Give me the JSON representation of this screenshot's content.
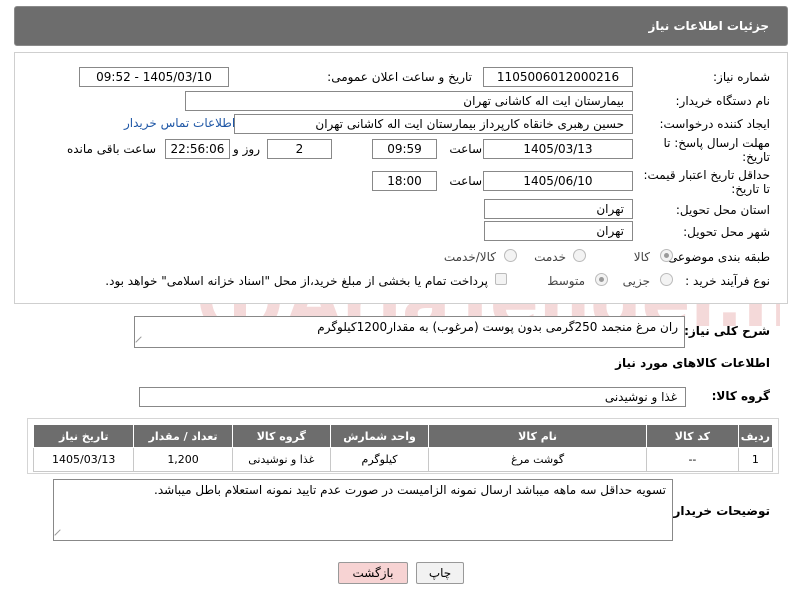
{
  "header": {
    "title": "جزئیات اطلاعات نیاز"
  },
  "labels": {
    "need_number": "شماره نیاز:",
    "announce_datetime": "تاریخ و ساعت اعلان عمومی:",
    "buyer_org": "نام دستگاه خریدار:",
    "requester": "ایجاد کننده درخواست:",
    "reply_deadline_1": "مهلت ارسال پاسخ: تا",
    "reply_deadline_2": "تاریخ:",
    "price_validity_1": "حداقل تاریخ اعتبار قیمت:",
    "price_validity_2": "تا تاریخ:",
    "time": "ساعت",
    "day_and": "روز و",
    "remaining": "ساعت باقی مانده",
    "province": "استان محل تحویل:",
    "city": "شهر محل تحویل:",
    "category": "طبقه بندی موضوعی:",
    "process_type": "نوع فرآیند خرید :",
    "general_desc": "شرح کلی نیاز:",
    "goods_info": "اطلاعات کالاهای مورد نیاز",
    "goods_group": "گروه کالا:",
    "buyer_notes": "توضیحات خریدار:"
  },
  "values": {
    "need_number": "1105006012000216",
    "announce_datetime": "1405/03/10 - 09:52",
    "buyer_org": "بیمارستان ایت اله کاشانی تهران",
    "requester": "حسین رهبری خانقاه کارپرداز بیمارستان ایت اله کاشانی تهران",
    "contact_link": "اطلاعات تماس خریدار",
    "reply_date": "1405/03/13",
    "reply_time": "09:59",
    "days": "2",
    "remaining_time": "22:56:06",
    "validity_date": "1405/06/10",
    "validity_time": "18:00",
    "province": "تهران",
    "city": "تهران",
    "general_desc": "ران مرغ منجمد 250گرمی بدون پوست (مرغوب) به مقدار1200کیلوگرم",
    "goods_group": "غذا و نوشیدنی",
    "buyer_notes": "تسویه حداقل سه ماهه میباشد ارسال نمونه الزامیست در صورت عدم تایید نمونه استعلام باطل میباشد."
  },
  "category_options": [
    "کالا",
    "خدمت",
    "کالا/خدمت"
  ],
  "category_selected": "کالا",
  "process_options": [
    "جزیی",
    "متوسط"
  ],
  "process_selected": "متوسط",
  "payment_note": "پرداخت تمام یا بخشی از مبلغ خرید،از محل \"اسناد خزانه اسلامی\" خواهد بود.",
  "table": {
    "headers": [
      "ردیف",
      "کد کالا",
      "نام کالا",
      "واحد شمارش",
      "گروه کالا",
      "تعداد / مقدار",
      "تاریخ نیاز"
    ],
    "rows": [
      [
        "1",
        "--",
        "گوشت مرغ",
        "کیلوگرم",
        "غذا و نوشیدنی",
        "1,200",
        "1405/03/13"
      ]
    ]
  },
  "buttons": {
    "print": "چاپ",
    "back": "بازگشت"
  },
  "watermark_text": "AriaTender.net",
  "colors": {
    "header_bg": "#6d6d6d",
    "link": "#1f57a6",
    "back_button": "#f7d3d3",
    "watermark": "#c83232"
  }
}
